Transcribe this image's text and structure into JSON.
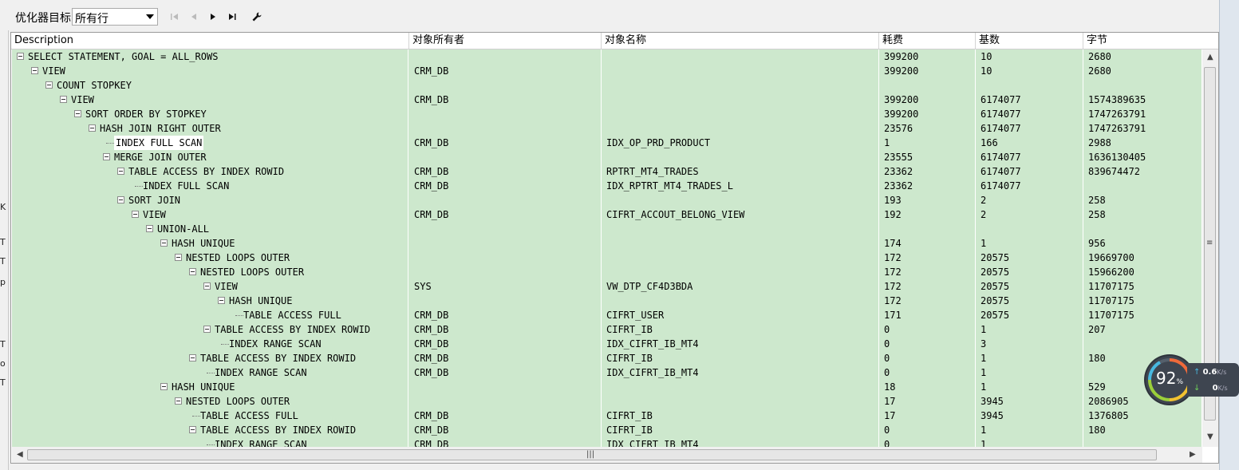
{
  "toolbar": {
    "optimizer_label": "优化器目标",
    "optimizer_value": "所有行"
  },
  "grid": {
    "columns": [
      "Description",
      "对象所有者",
      "对象名称",
      "耗费",
      "基数",
      "字节"
    ],
    "rows": [
      {
        "depth": 0,
        "expander": true,
        "desc": "SELECT STATEMENT, GOAL = ALL_ROWS",
        "owner": "",
        "name": "",
        "cost": "399200",
        "card": "10",
        "bytes": "2680"
      },
      {
        "depth": 1,
        "expander": true,
        "desc": "VIEW",
        "owner": "CRM_DB",
        "name": "",
        "cost": "399200",
        "card": "10",
        "bytes": "2680"
      },
      {
        "depth": 2,
        "expander": true,
        "desc": "COUNT STOPKEY",
        "owner": "",
        "name": "",
        "cost": "",
        "card": "",
        "bytes": ""
      },
      {
        "depth": 3,
        "expander": true,
        "desc": "VIEW",
        "owner": "CRM_DB",
        "name": "",
        "cost": "399200",
        "card": "6174077",
        "bytes": "1574389635"
      },
      {
        "depth": 4,
        "expander": true,
        "desc": "SORT ORDER BY STOPKEY",
        "owner": "",
        "name": "",
        "cost": "399200",
        "card": "6174077",
        "bytes": "1747263791"
      },
      {
        "depth": 5,
        "expander": true,
        "desc": "HASH JOIN RIGHT OUTER",
        "owner": "",
        "name": "",
        "cost": "23576",
        "card": "6174077",
        "bytes": "1747263791"
      },
      {
        "depth": 6,
        "expander": false,
        "selected": true,
        "desc": "INDEX FULL SCAN",
        "owner": "CRM_DB",
        "name": "IDX_OP_PRD_PRODUCT",
        "cost": "1",
        "card": "166",
        "bytes": "2988"
      },
      {
        "depth": 6,
        "expander": true,
        "desc": "MERGE JOIN OUTER",
        "owner": "",
        "name": "",
        "cost": "23555",
        "card": "6174077",
        "bytes": "1636130405"
      },
      {
        "depth": 7,
        "expander": true,
        "desc": "TABLE ACCESS BY INDEX ROWID",
        "owner": "CRM_DB",
        "name": "RPTRT_MT4_TRADES",
        "cost": "23362",
        "card": "6174077",
        "bytes": "839674472"
      },
      {
        "depth": 8,
        "expander": false,
        "desc": "INDEX FULL SCAN",
        "owner": "CRM_DB",
        "name": "IDX_RPTRT_MT4_TRADES_L",
        "cost": "23362",
        "card": "6174077",
        "bytes": ""
      },
      {
        "depth": 7,
        "expander": true,
        "desc": "SORT JOIN",
        "owner": "",
        "name": "",
        "cost": "193",
        "card": "2",
        "bytes": "258"
      },
      {
        "depth": 8,
        "expander": true,
        "desc": "VIEW",
        "owner": "CRM_DB",
        "name": "CIFRT_ACCOUT_BELONG_VIEW",
        "cost": "192",
        "card": "2",
        "bytes": "258"
      },
      {
        "depth": 9,
        "expander": true,
        "desc": "UNION-ALL",
        "owner": "",
        "name": "",
        "cost": "",
        "card": "",
        "bytes": ""
      },
      {
        "depth": 10,
        "expander": true,
        "desc": "HASH UNIQUE",
        "owner": "",
        "name": "",
        "cost": "174",
        "card": "1",
        "bytes": "956"
      },
      {
        "depth": 11,
        "expander": true,
        "desc": "NESTED LOOPS OUTER",
        "owner": "",
        "name": "",
        "cost": "172",
        "card": "20575",
        "bytes": "19669700"
      },
      {
        "depth": 12,
        "expander": true,
        "desc": "NESTED LOOPS OUTER",
        "owner": "",
        "name": "",
        "cost": "172",
        "card": "20575",
        "bytes": "15966200"
      },
      {
        "depth": 13,
        "expander": true,
        "desc": "VIEW",
        "owner": "SYS",
        "name": "VW_DTP_CF4D3BDA",
        "cost": "172",
        "card": "20575",
        "bytes": "11707175"
      },
      {
        "depth": 14,
        "expander": true,
        "desc": "HASH UNIQUE",
        "owner": "",
        "name": "",
        "cost": "172",
        "card": "20575",
        "bytes": "11707175"
      },
      {
        "depth": 15,
        "expander": false,
        "desc": "TABLE ACCESS FULL",
        "owner": "CRM_DB",
        "name": "CIFRT_USER",
        "cost": "171",
        "card": "20575",
        "bytes": "11707175"
      },
      {
        "depth": 13,
        "expander": true,
        "desc": "TABLE ACCESS BY INDEX ROWID",
        "owner": "CRM_DB",
        "name": "CIFRT_IB",
        "cost": "0",
        "card": "1",
        "bytes": "207"
      },
      {
        "depth": 14,
        "expander": false,
        "desc": "INDEX RANGE SCAN",
        "owner": "CRM_DB",
        "name": "IDX_CIFRT_IB_MT4",
        "cost": "0",
        "card": "3",
        "bytes": ""
      },
      {
        "depth": 12,
        "expander": true,
        "desc": "TABLE ACCESS BY INDEX ROWID",
        "owner": "CRM_DB",
        "name": "CIFRT_IB",
        "cost": "0",
        "card": "1",
        "bytes": "180"
      },
      {
        "depth": 13,
        "expander": false,
        "desc": "INDEX RANGE SCAN",
        "owner": "CRM_DB",
        "name": "IDX_CIFRT_IB_MT4",
        "cost": "0",
        "card": "1",
        "bytes": ""
      },
      {
        "depth": 10,
        "expander": true,
        "desc": "HASH UNIQUE",
        "owner": "",
        "name": "",
        "cost": "18",
        "card": "1",
        "bytes": "529"
      },
      {
        "depth": 11,
        "expander": true,
        "desc": "NESTED LOOPS OUTER",
        "owner": "",
        "name": "",
        "cost": "17",
        "card": "3945",
        "bytes": "2086905"
      },
      {
        "depth": 12,
        "expander": false,
        "desc": "TABLE ACCESS FULL",
        "owner": "CRM_DB",
        "name": "CIFRT_IB",
        "cost": "17",
        "card": "3945",
        "bytes": "1376805"
      },
      {
        "depth": 12,
        "expander": true,
        "desc": "TABLE ACCESS BY INDEX ROWID",
        "owner": "CRM_DB",
        "name": "CIFRT_IB",
        "cost": "0",
        "card": "1",
        "bytes": "180"
      },
      {
        "depth": 13,
        "expander": false,
        "desc": "INDEX RANGE SCAN",
        "owner": "CRM_DB",
        "name": "IDX_CIFRT_IB_MT4",
        "cost": "0",
        "card": "1",
        "bytes": ""
      }
    ]
  },
  "monitor": {
    "cpu_percent": "92",
    "percent_sign": "%",
    "upload": "0.6",
    "upload_unit": "K/s",
    "download": "0",
    "download_unit": "K/s"
  },
  "left_strip_glyphs": [
    "K",
    "T",
    "T",
    "p",
    "T",
    "o",
    "T"
  ],
  "colors": {
    "row_bg": "#cde8cd",
    "monitor_bg": "#3e4550"
  }
}
